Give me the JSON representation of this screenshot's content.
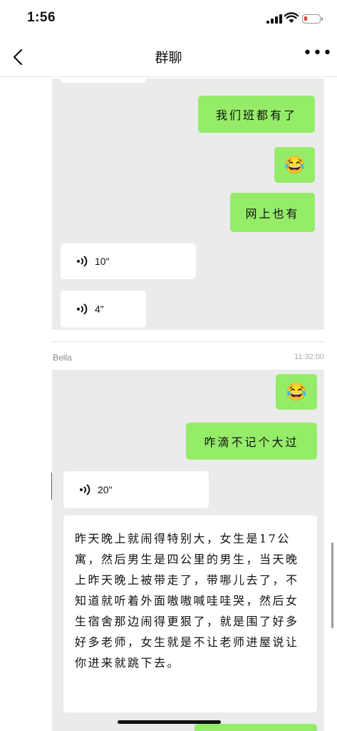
{
  "status_bar": {
    "time": "1:56"
  },
  "nav": {
    "title": "群聊",
    "more": "•••"
  },
  "pane1": {
    "messages": [
      {
        "kind": "text",
        "side": "right",
        "text": "我们班都有了"
      },
      {
        "kind": "emoji",
        "side": "right",
        "text": "😂"
      },
      {
        "kind": "text",
        "side": "right",
        "text": "网上也有"
      },
      {
        "kind": "voice",
        "side": "left",
        "duration": "10\""
      },
      {
        "kind": "voice",
        "side": "left",
        "duration": "4\""
      }
    ]
  },
  "group_message": {
    "sender": "Bella",
    "time": "11:32:00"
  },
  "pane2": {
    "messages": [
      {
        "kind": "emoji",
        "side": "right",
        "text": "😂"
      },
      {
        "kind": "text",
        "side": "right",
        "text": "咋滴不记个大过"
      },
      {
        "kind": "voice",
        "side": "left",
        "duration": "20\""
      },
      {
        "kind": "text",
        "side": "left",
        "text": "昨天晚上就闹得特别大，女生是17公寓，然后男生是四公里的男生，当天晚上昨天晚上被带走了，带哪儿去了，不知道就听着外面嗷嗷喊哇哇哭，然后女生宿舍那边闹得更狠了，就是围了好多好多老师，女生就是不让老师进屋说让你进来就跳下去。"
      }
    ]
  }
}
